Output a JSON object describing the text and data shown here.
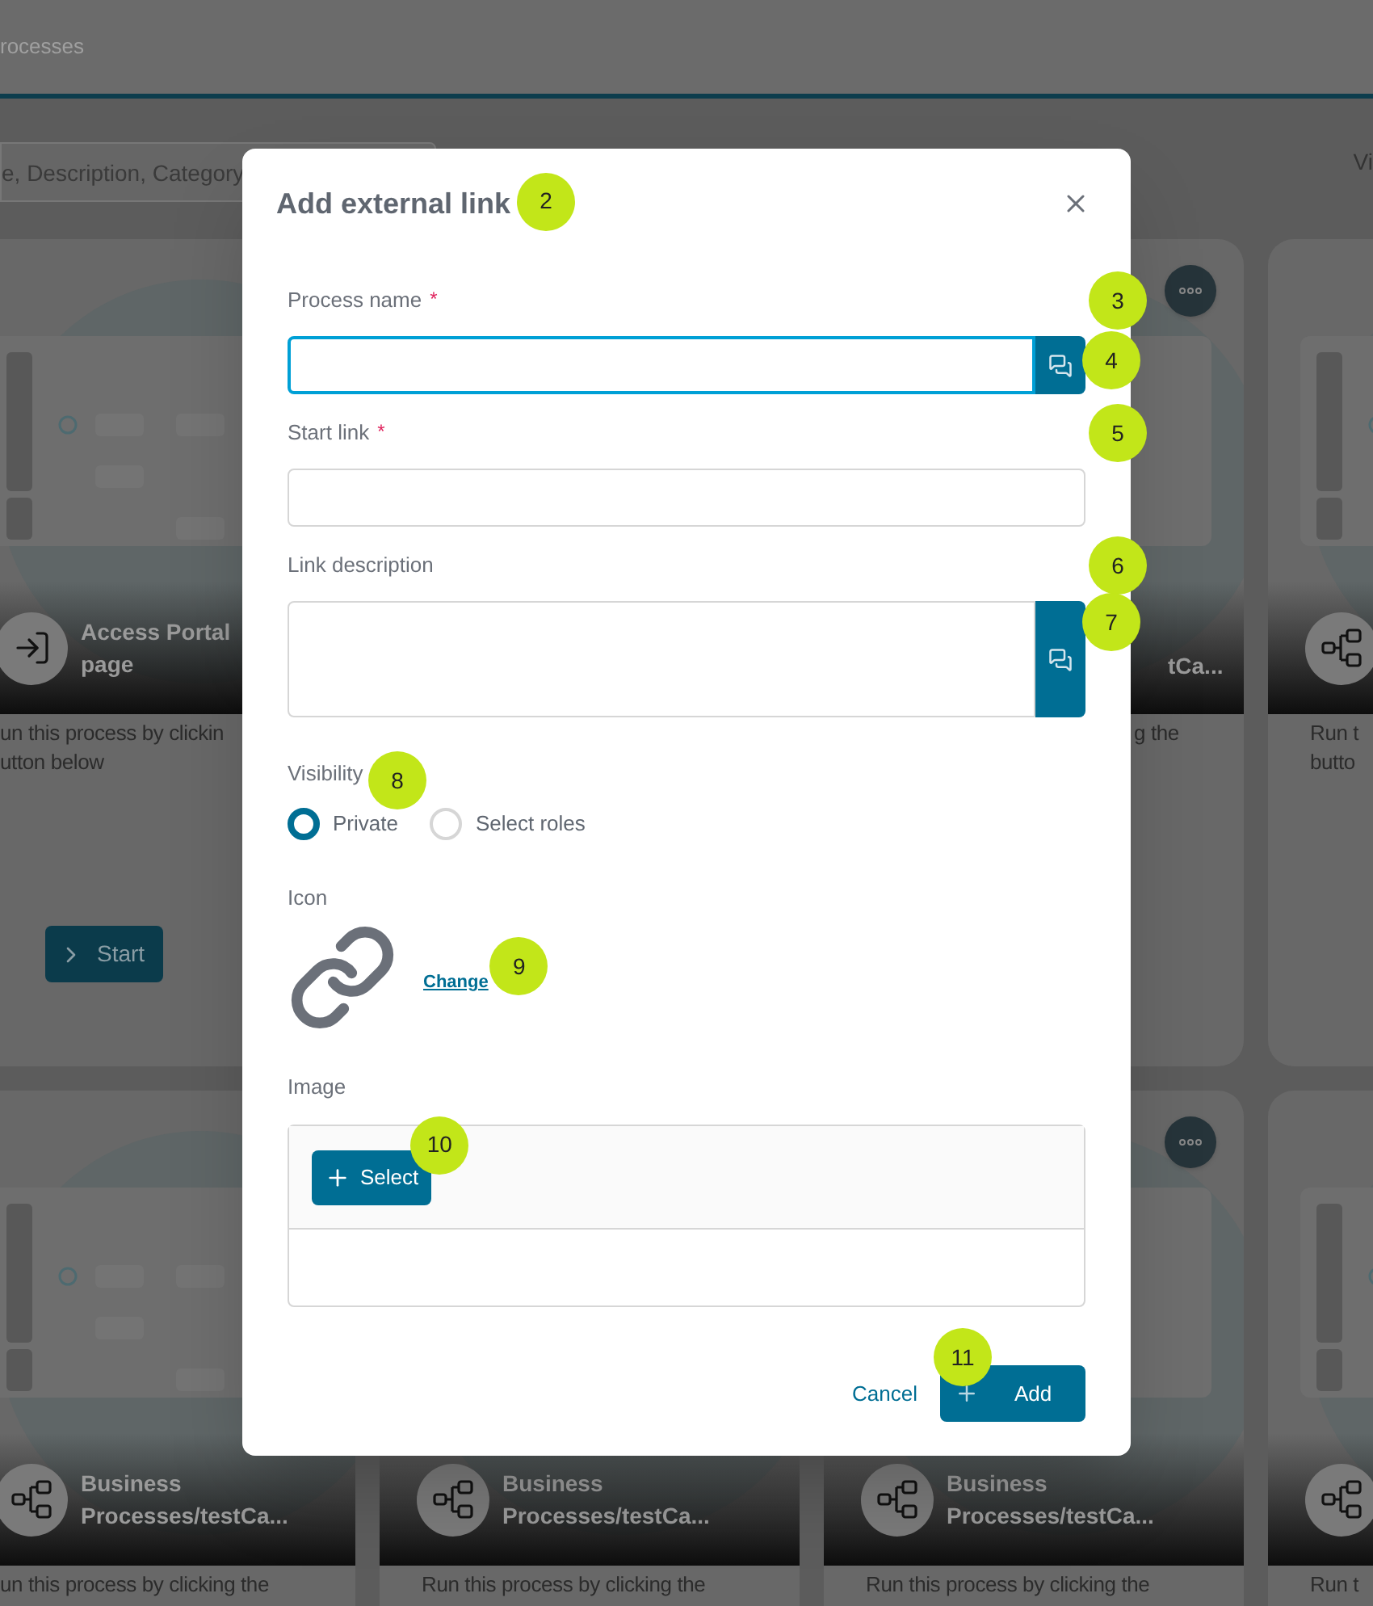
{
  "page": {
    "breadcrumb": "rocesses",
    "search": {
      "placeholder": "e, Description, Category"
    },
    "view_label": "Vi"
  },
  "card_rows": [
    [
      {
        "kind": "portal",
        "title_lines": [
          "Access Portal",
          "page"
        ],
        "description_lines": [
          "un this process by clickin",
          "utton below"
        ],
        "start_button": "Start"
      },
      {
        "kind": "hidden"
      },
      {
        "kind": "clipped",
        "more_button": true,
        "title_lines": [
          "tCa..."
        ],
        "description_lines": [
          "g the"
        ]
      },
      {
        "kind": "process",
        "description_lines": [
          "Run t",
          "butto"
        ]
      }
    ],
    [
      {
        "kind": "process",
        "title_lines": [
          "Business",
          "Processes/testCa..."
        ],
        "description_lines": [
          "un this process by clicking the"
        ]
      },
      {
        "kind": "process",
        "title_lines": [
          "Business",
          "Processes/testCa..."
        ],
        "description_lines": [
          "Run this process by clicking the"
        ]
      },
      {
        "kind": "process",
        "more_button": true,
        "title_lines": [
          "Business",
          "Processes/testCa..."
        ],
        "description_lines": [
          "Run this process by clicking the"
        ]
      },
      {
        "kind": "process",
        "description_lines": [
          "Run t"
        ]
      }
    ]
  ],
  "dialog": {
    "title": "Add external link",
    "title_callout": "2",
    "fields": [
      {
        "kind": "input",
        "label": "Process name",
        "required_mark": "*",
        "focused": true,
        "translate_button": true,
        "callout": "3",
        "button_callout": "4"
      },
      {
        "kind": "input",
        "label": "Start link",
        "required_mark": "*",
        "focused": false,
        "translate_button": false,
        "callout": "5"
      },
      {
        "kind": "textarea",
        "label": "Link description",
        "focused": false,
        "translate_button": true,
        "callout": "6",
        "button_callout": "7"
      }
    ],
    "visibility": {
      "label": "Visibility",
      "callout": "8",
      "options": [
        {
          "label": "Private",
          "selected": true
        },
        {
          "label": "Select roles",
          "selected": false
        }
      ]
    },
    "icon": {
      "label": "Icon",
      "change_link": "Change",
      "callout": "9"
    },
    "image": {
      "label": "Image",
      "select_button": "Select",
      "callout": "10"
    },
    "footer": {
      "cancel": "Cancel",
      "add": "Add",
      "callout": "11"
    }
  }
}
